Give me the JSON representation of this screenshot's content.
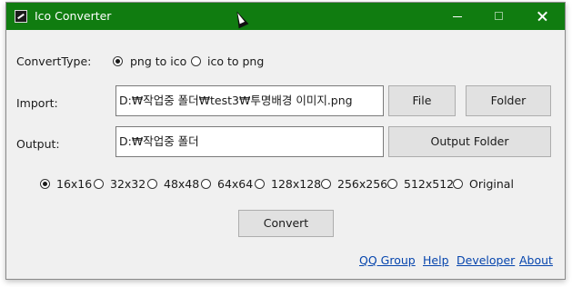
{
  "window": {
    "title": "Ico Converter"
  },
  "convert_type": {
    "label": "ConvertType:",
    "options": [
      {
        "label": "png to ico",
        "selected": true
      },
      {
        "label": "ico to png",
        "selected": false
      }
    ]
  },
  "import": {
    "label": "Import:",
    "value": "D:₩작업중 폴더₩test3₩투명배경 이미지.png",
    "file_button": "File",
    "folder_button": "Folder"
  },
  "output": {
    "label": "Output:",
    "value": "D:₩작업중 폴더",
    "folder_button": "Output Folder"
  },
  "sizes": [
    {
      "label": "16x16",
      "selected": true
    },
    {
      "label": "32x32",
      "selected": false
    },
    {
      "label": "48x48",
      "selected": false
    },
    {
      "label": "64x64",
      "selected": false
    },
    {
      "label": "128x128",
      "selected": false
    },
    {
      "label": "256x256",
      "selected": false
    },
    {
      "label": "512x512",
      "selected": false
    },
    {
      "label": "Original",
      "selected": false
    }
  ],
  "convert_button": "Convert",
  "links": [
    "QQ Group",
    "Help",
    "Developer",
    "About"
  ],
  "colors": {
    "titlebar": "#107c10",
    "link": "#0645ad"
  },
  "icons": [
    "app-icon",
    "minimize-icon",
    "maximize-icon",
    "close-icon",
    "mouse-cursor-icon"
  ]
}
